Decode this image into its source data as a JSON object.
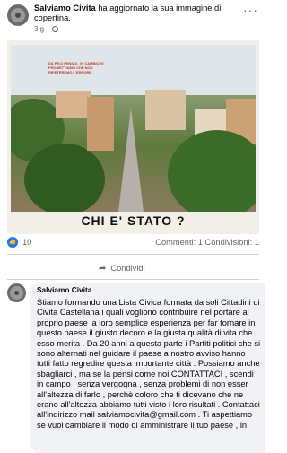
{
  "post": {
    "author": "Salviamo Civita",
    "action": "ha aggiornato la sua immagine di copertina.",
    "time": "3 g",
    "more_label": "···"
  },
  "cover": {
    "overlay_text": "DA PECI PENSIA , IN CAMBIO VI PROMETTIAMO CHE NON RIPETEREMO L'ERRORE",
    "caption": "CHI E' STATO ?"
  },
  "stats": {
    "reactions": "10",
    "comments": "Commenti: 1",
    "shares": "Condivisioni: 1"
  },
  "actions": {
    "share_label": "Condividi"
  },
  "comment": {
    "author": "Salviamo Civita",
    "text": "Stiamo formando una Lista Civica formata da soli Cittadini di Civita Castellana i quali vogliono contribuire nel portare al proprio paese la loro semplice esperienza per far tornare in questo paese il giusto decoro e la giusta qualità di vita che esso merita . Da 20 anni a questa parte i Partiti politici che si sono alternati nel guidare il paese a nostro avviso hanno tutti fatto regredire questa importante città . Possiamo anche sbagliarci , ma se la pensi come noi CONTATTACI , scendi in campo , senza vergogna , senza problemi di non esser all'altezza di farlo , perchè coloro che ti dicevano che ne erano all'altezza abbiamo tutti visto i loro risultati . Contattaci all'indirizzo mail salviamocivita@gmail.com . Ti aspettiamo se vuoi cambiare il modo di amministrare il tuo paese , in"
  }
}
